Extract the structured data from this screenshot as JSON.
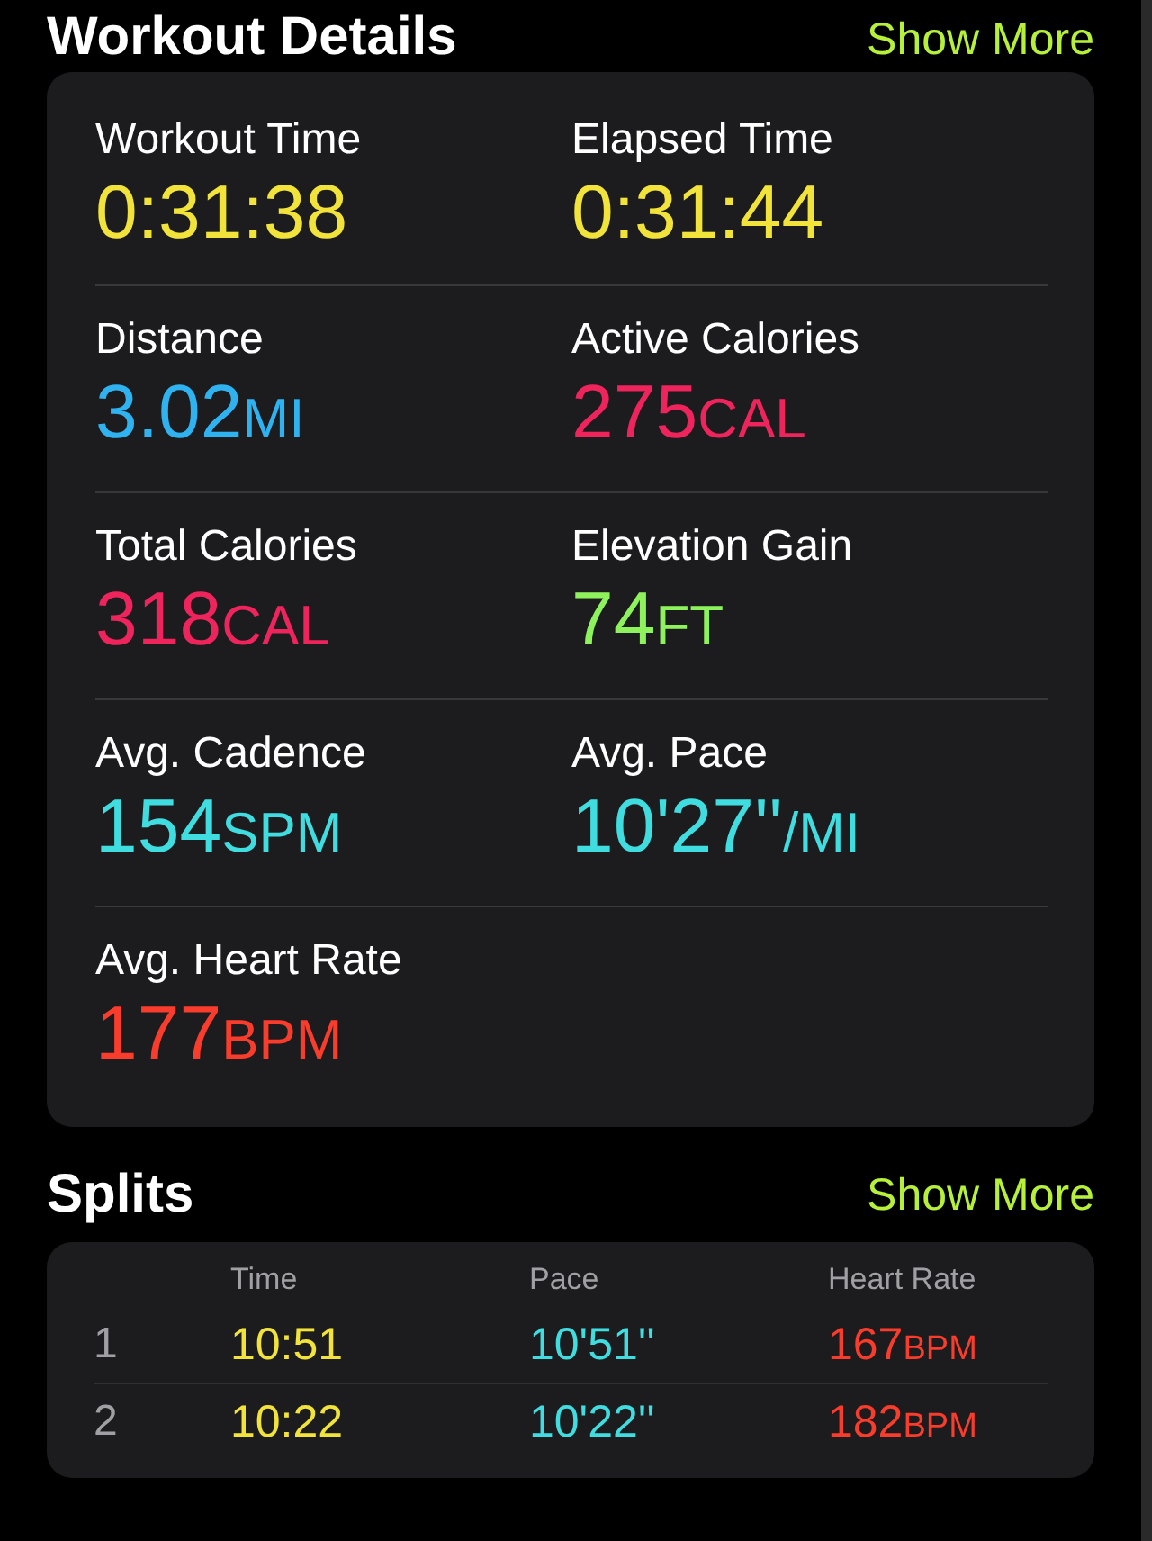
{
  "workout_details": {
    "title": "Workout Details",
    "show_more": "Show More",
    "metrics": [
      {
        "label": "Workout Time",
        "value": "0:31:38",
        "color": "#f2e33a"
      },
      {
        "label": "Elapsed Time",
        "value": "0:31:44",
        "color": "#f2e33a"
      },
      {
        "label": "Distance",
        "value": "3.02",
        "unit": "MI",
        "color": "#2fb2f0"
      },
      {
        "label": "Active Calories",
        "value": "275",
        "unit": "CAL",
        "color": "#f0245c"
      },
      {
        "label": "Total Calories",
        "value": "318",
        "unit": "CAL",
        "color": "#f0245c"
      },
      {
        "label": "Elevation Gain",
        "value": "74",
        "unit": "FT",
        "color": "#8df25c"
      },
      {
        "label": "Avg. Cadence",
        "value": "154",
        "unit": "SPM",
        "color": "#3fdce0"
      },
      {
        "label": "Avg. Pace",
        "value": "10'27''",
        "unit": "/MI",
        "color": "#3fdce0"
      },
      {
        "label": "Avg. Heart Rate",
        "value": "177",
        "unit": "BPM",
        "color": "#fa3c2c"
      }
    ]
  },
  "splits": {
    "title": "Splits",
    "show_more": "Show More",
    "columns": [
      "Time",
      "Pace",
      "Heart Rate"
    ],
    "rows": [
      {
        "index": "1",
        "time": "10:51",
        "pace": "10'51''",
        "heart_rate": "167",
        "unit": "BPM"
      },
      {
        "index": "2",
        "time": "10:22",
        "pace": "10'22''",
        "heart_rate": "182",
        "unit": "BPM"
      }
    ]
  }
}
